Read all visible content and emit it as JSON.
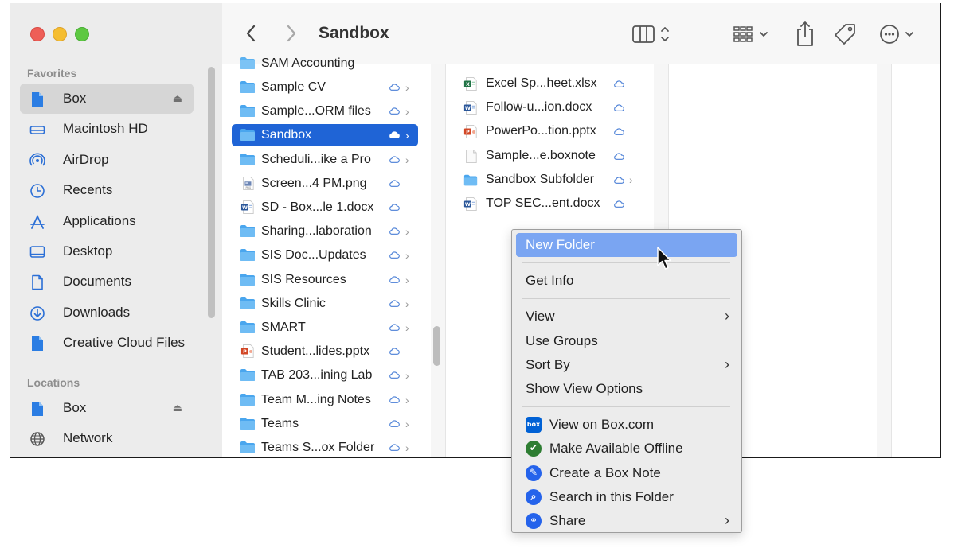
{
  "window": {
    "title": "Sandbox"
  },
  "sidebar": {
    "favorites_heading": "Favorites",
    "favorites": [
      {
        "label": "Box",
        "icon": "box-file-icon",
        "eject": "⏏",
        "selected": true
      },
      {
        "label": "Macintosh HD",
        "icon": "hard-drive-icon"
      },
      {
        "label": "AirDrop",
        "icon": "airdrop-icon"
      },
      {
        "label": "Recents",
        "icon": "clock-icon"
      },
      {
        "label": "Applications",
        "icon": "applications-icon"
      },
      {
        "label": "Desktop",
        "icon": "desktop-icon"
      },
      {
        "label": "Documents",
        "icon": "document-icon"
      },
      {
        "label": "Downloads",
        "icon": "download-icon"
      },
      {
        "label": "Creative Cloud Files",
        "icon": "file-icon"
      }
    ],
    "locations_heading": "Locations",
    "locations": [
      {
        "label": "Box",
        "icon": "box-file-icon",
        "eject": "⏏"
      },
      {
        "label": "Network",
        "icon": "globe-icon"
      }
    ]
  },
  "toolbar": {
    "back": "back-chevron-icon",
    "forward": "forward-chevron-icon",
    "title": "Sandbox",
    "view_button": "column-view-icon",
    "group_button": "group-icon",
    "share_button": "share-icon",
    "tag_button": "tag-icon",
    "more_button": "more-icon"
  },
  "column1": {
    "partial_top": "SAM Accounting",
    "items": [
      {
        "label": "Sample CV",
        "type": "folder",
        "chevron": true
      },
      {
        "label": "Sample...ORM files",
        "type": "folder",
        "chevron": true
      },
      {
        "label": "Sandbox",
        "type": "folder",
        "chevron": true,
        "selected": true
      },
      {
        "label": "Scheduli...ike a Pro",
        "type": "folder",
        "chevron": true
      },
      {
        "label": "Screen...4 PM.png",
        "type": "png",
        "chevron": false
      },
      {
        "label": "SD - Box...le 1.docx",
        "type": "docx",
        "chevron": false
      },
      {
        "label": "Sharing...laboration",
        "type": "folder",
        "chevron": true
      },
      {
        "label": "SIS Doc...Updates",
        "type": "folder",
        "chevron": true
      },
      {
        "label": "SIS Resources",
        "type": "folder",
        "chevron": true
      },
      {
        "label": "Skills Clinic",
        "type": "folder",
        "chevron": true
      },
      {
        "label": "SMART",
        "type": "folder",
        "chevron": true
      },
      {
        "label": "Student...lides.pptx",
        "type": "pptx",
        "chevron": false
      },
      {
        "label": "TAB 203...ining Lab",
        "type": "folder",
        "chevron": true
      },
      {
        "label": "Team M...ing Notes",
        "type": "folder",
        "chevron": true
      },
      {
        "label": "Teams",
        "type": "folder",
        "chevron": true
      },
      {
        "label": "Teams S...ox Folder",
        "type": "folder",
        "chevron": true
      }
    ]
  },
  "column2": {
    "items": [
      {
        "label": "Excel Sp...heet.xlsx",
        "type": "xlsx",
        "chevron": false
      },
      {
        "label": "Follow-u...ion.docx",
        "type": "docx",
        "chevron": false
      },
      {
        "label": "PowerPo...tion.pptx",
        "type": "pptx",
        "chevron": false
      },
      {
        "label": "Sample...e.boxnote",
        "type": "boxnote",
        "chevron": false
      },
      {
        "label": "Sandbox Subfolder",
        "type": "folder",
        "chevron": true
      },
      {
        "label": "TOP SEC...ent.docx",
        "type": "docx",
        "chevron": false
      }
    ]
  },
  "context_menu": {
    "groups": [
      [
        {
          "label": "New Folder",
          "highlighted": true
        }
      ],
      [
        {
          "label": "Get Info"
        }
      ],
      [
        {
          "label": "View",
          "submenu": true
        },
        {
          "label": "Use Groups"
        },
        {
          "label": "Sort By",
          "submenu": true
        },
        {
          "label": "Show View Options"
        }
      ],
      [
        {
          "label": "View on Box.com",
          "icon": "box-logo-icon",
          "icon_text": "box",
          "color": "#0061d5"
        },
        {
          "label": "Make Available Offline",
          "icon": "checkmark-circle-icon",
          "icon_text": "✔",
          "color": "#2e7d32"
        },
        {
          "label": "Create a Box Note",
          "icon": "note-pencil-icon",
          "icon_text": "✎",
          "color": "#2563eb"
        },
        {
          "label": "Search in this Folder",
          "icon": "folder-search-icon",
          "icon_text": "⌕",
          "color": "#2563eb"
        },
        {
          "label": "Share",
          "icon": "link-icon",
          "icon_text": "⚭",
          "color": "#2563eb",
          "submenu": true
        }
      ]
    ],
    "submenu_glyph": "›"
  },
  "colors": {
    "selection_blue": "#1f64d6",
    "menu_highlight": "#7aa5f2",
    "folder_blue": "#5cb2f1",
    "cloud_blue": "#4a7fd6"
  }
}
